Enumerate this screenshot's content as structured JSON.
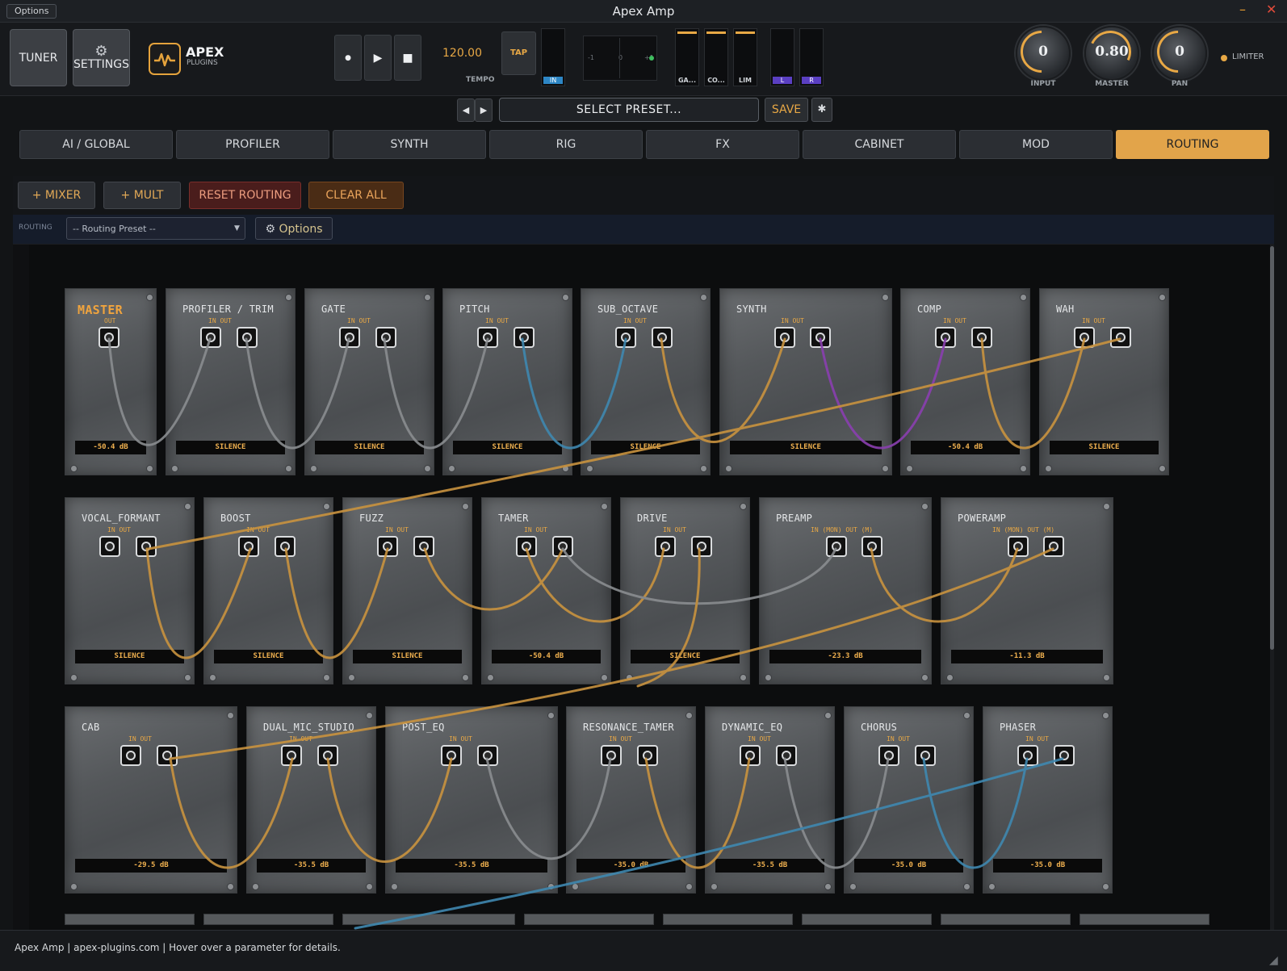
{
  "window": {
    "options_label": "Options",
    "title": "Apex Amp",
    "minimize_glyph": "–",
    "close_glyph": "✕"
  },
  "header": {
    "tuner_label": "TUNER",
    "settings_label": "SETTINGS",
    "settings_icon": "gear-icon",
    "logo_text": "APEX",
    "logo_sub": "PLUGINS",
    "transport": {
      "record_glyph": "●",
      "play_glyph": "▶",
      "stop_glyph": "■"
    },
    "tempo_value": "120.00",
    "tempo_label": "TEMPO",
    "tap_label": "TAP",
    "in_meter_label": "IN",
    "pan_scale": [
      "-1",
      "0",
      "+1"
    ],
    "meters": [
      {
        "label": "GA..."
      },
      {
        "label": "CO..."
      },
      {
        "label": "LIM"
      }
    ],
    "lr_meters": [
      "L",
      "R"
    ],
    "knobs": [
      {
        "label": "INPUT",
        "value": "0"
      },
      {
        "label": "MASTER",
        "value": "0.80"
      },
      {
        "label": "PAN",
        "value": "0"
      }
    ],
    "limiter_label": "LIMITER",
    "accent": "#e8a845"
  },
  "preset_bar": {
    "prev_glyph": "◀",
    "next_glyph": "▶",
    "preset_label": "SELECT PRESET...",
    "save_label": "SAVE",
    "star_glyph": "✱"
  },
  "tabs": [
    {
      "label": "AI / GLOBAL",
      "active": false
    },
    {
      "label": "PROFILER",
      "active": false
    },
    {
      "label": "SYNTH",
      "active": false
    },
    {
      "label": "RIG",
      "active": false
    },
    {
      "label": "FX",
      "active": false
    },
    {
      "label": "CABINET",
      "active": false
    },
    {
      "label": "MOD",
      "active": false
    },
    {
      "label": "ROUTING",
      "active": true
    }
  ],
  "routing_toolbar": {
    "mixer_label": "+ MIXER",
    "mult_label": "+ MULT",
    "reset_label": "RESET ROUTING",
    "clear_label": "CLEAR ALL",
    "routing_label": "ROUTING",
    "routing_preset_placeholder": "-- Routing Preset --",
    "options_label": "Options"
  },
  "modules": {
    "row1": [
      {
        "name": "MASTER",
        "io": "OUT",
        "display": "-50.4 dB"
      },
      {
        "name": "PROFILER / TRIM",
        "io": "IN   OUT",
        "display": "SILENCE"
      },
      {
        "name": "GATE",
        "io": "IN   OUT",
        "display": "SILENCE"
      },
      {
        "name": "PITCH",
        "io": "IN   OUT",
        "display": "SILENCE"
      },
      {
        "name": "SUB_OCTAVE",
        "io": "IN   OUT",
        "display": "SILENCE"
      },
      {
        "name": "SYNTH",
        "io": "IN   OUT",
        "display": "SILENCE"
      },
      {
        "name": "COMP",
        "io": "IN   OUT",
        "display": "-50.4 dB"
      },
      {
        "name": "WAH",
        "io": "IN   OUT",
        "display": "SILENCE"
      }
    ],
    "row2": [
      {
        "name": "VOCAL_FORMANT",
        "io": "IN   OUT",
        "display": "SILENCE"
      },
      {
        "name": "BOOST",
        "io": "IN   OUT",
        "display": "SILENCE"
      },
      {
        "name": "FUZZ",
        "io": "IN   OUT",
        "display": "SILENCE"
      },
      {
        "name": "TAMER",
        "io": "IN   OUT",
        "display": "-50.4 dB"
      },
      {
        "name": "DRIVE",
        "io": "IN   OUT",
        "display": "SILENCE"
      },
      {
        "name": "PREAMP",
        "io": "IN (MON) OUT (M)",
        "display": "-23.3 dB"
      },
      {
        "name": "POWERAMP",
        "io": "IN (MON) OUT (M)",
        "display": "-11.3 dB"
      }
    ],
    "row3": [
      {
        "name": "CAB",
        "io": "IN   OUT",
        "display": "-29.5 dB"
      },
      {
        "name": "DUAL_MIC_STUDIO",
        "io": "IN   OUT",
        "display": "-35.5 dB"
      },
      {
        "name": "POST_EQ",
        "io": "IN   OUT",
        "display": "-35.5 dB"
      },
      {
        "name": "RESONANCE_TAMER",
        "io": "IN   OUT",
        "display": "-35.0 dB"
      },
      {
        "name": "DYNAMIC_EQ",
        "io": "IN   OUT",
        "display": "-35.5 dB"
      },
      {
        "name": "CHORUS",
        "io": "IN   OUT",
        "display": "-35.0 dB"
      },
      {
        "name": "PHASER",
        "io": "IN   OUT",
        "display": "-35.0 dB"
      }
    ]
  },
  "cable_colors": {
    "default": "#8a8d90",
    "amber": "#c9933f",
    "blue": "#3f88b0",
    "purple": "#8a3fb0"
  },
  "status": {
    "text": "Apex Amp | apex-plugins.com | Hover over a parameter for details."
  }
}
